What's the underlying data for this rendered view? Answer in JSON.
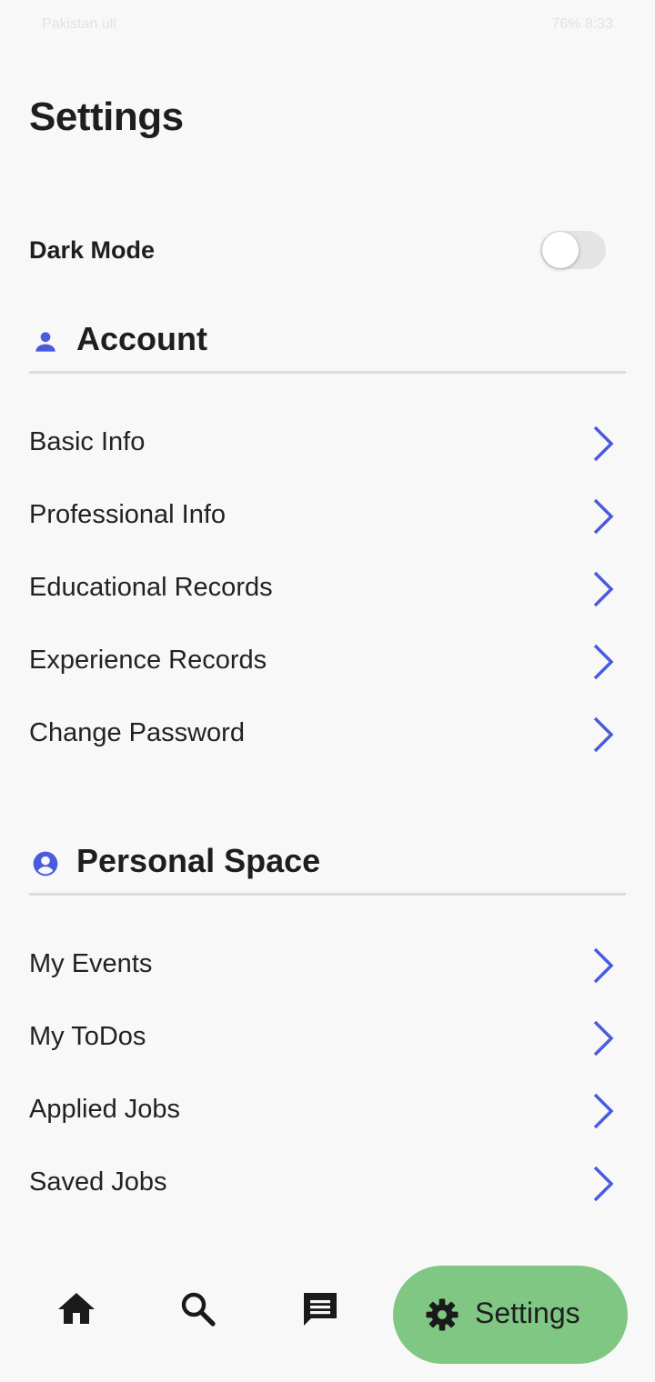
{
  "status_bar": {
    "left": "Pakistan ull",
    "right": "76% 8:33"
  },
  "page": {
    "title": "Settings"
  },
  "dark_mode": {
    "label": "Dark Mode",
    "enabled": false
  },
  "account": {
    "title": "Account",
    "icon": "person-icon",
    "items": [
      {
        "label": "Basic Info"
      },
      {
        "label": "Professional Info"
      },
      {
        "label": "Educational Records"
      },
      {
        "label": "Experience Records"
      },
      {
        "label": "Change Password"
      }
    ]
  },
  "personal_space": {
    "title": "Personal Space",
    "icon": "account-circle-icon",
    "items": [
      {
        "label": "My Events"
      },
      {
        "label": "My ToDos"
      },
      {
        "label": "Applied Jobs"
      },
      {
        "label": "Saved Jobs"
      }
    ]
  },
  "bottom_nav": {
    "items": [
      {
        "icon": "home-icon"
      },
      {
        "icon": "search-icon"
      },
      {
        "icon": "chat-icon"
      }
    ],
    "active": {
      "icon": "gear-icon",
      "label": "Settings"
    }
  },
  "colors": {
    "accent": "#4a5bdc",
    "active_nav_bg": "#80c783",
    "background": "#f8f8f8",
    "divider": "#dcdcdc"
  }
}
